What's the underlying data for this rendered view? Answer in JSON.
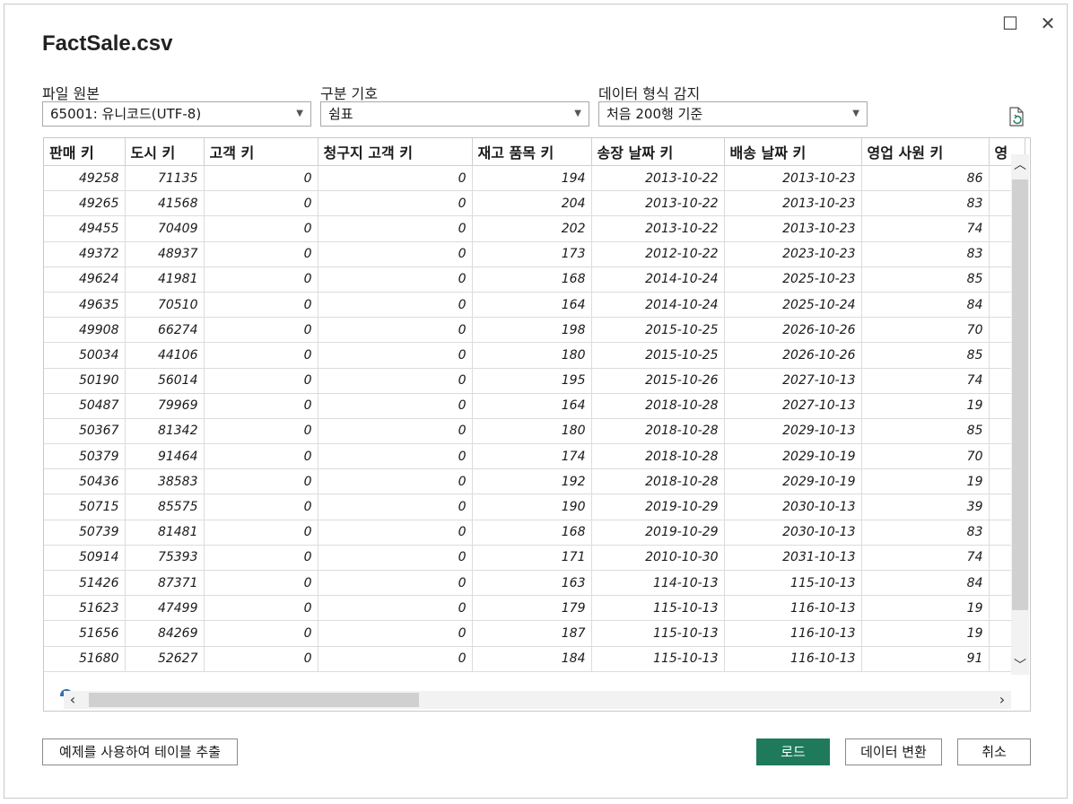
{
  "title": "FactSale.csv",
  "file_origin": {
    "label": "파일 원본",
    "value": "65001: 유니코드(UTF-8)"
  },
  "delimiter": {
    "label": "구분 기호",
    "value": "쉼표"
  },
  "detect": {
    "label": "데이터 형식 감지",
    "value": "처음 200행 기준"
  },
  "columns": [
    "판매 키",
    "도시 키",
    "고객 키",
    "청구지 고객 키",
    "재고 품목 키",
    "송장 날짜 키",
    "배송 날짜 키",
    "영업 사원 키",
    "영"
  ],
  "rows": [
    [
      "49258",
      "71135",
      "0",
      "0",
      "194",
      "2013-10-22",
      "2013-10-23",
      "86"
    ],
    [
      "49265",
      "41568",
      "0",
      "0",
      "204",
      "2013-10-22",
      "2013-10-23",
      "83"
    ],
    [
      "49455",
      "70409",
      "0",
      "0",
      "202",
      "2013-10-22",
      "2013-10-23",
      "74"
    ],
    [
      "49372",
      "48937",
      "0",
      "0",
      "173",
      "2012-10-22",
      "2023-10-23",
      "83"
    ],
    [
      "49624",
      "41981",
      "0",
      "0",
      "168",
      "2014-10-24",
      "2025-10-23",
      "85"
    ],
    [
      "49635",
      "70510",
      "0",
      "0",
      "164",
      "2014-10-24",
      "2025-10-24",
      "84"
    ],
    [
      "49908",
      "66274",
      "0",
      "0",
      "198",
      "2015-10-25",
      "2026-10-26",
      "70"
    ],
    [
      "50034",
      "44106",
      "0",
      "0",
      "180",
      "2015-10-25",
      "2026-10-26",
      "85"
    ],
    [
      "50190",
      "56014",
      "0",
      "0",
      "195",
      "2015-10-26",
      "2027-10-13",
      "74"
    ],
    [
      "50487",
      "79969",
      "0",
      "0",
      "164",
      "2018-10-28",
      "2027-10-13",
      "19"
    ],
    [
      "50367",
      "81342",
      "0",
      "0",
      "180",
      "2018-10-28",
      "2029-10-13",
      "85"
    ],
    [
      "50379",
      "91464",
      "0",
      "0",
      "174",
      "2018-10-28",
      "2029-10-19",
      "70"
    ],
    [
      "50436",
      "38583",
      "0",
      "0",
      "192",
      "2018-10-28",
      "2029-10-19",
      "19"
    ],
    [
      "50715",
      "85575",
      "0",
      "0",
      "190",
      "2019-10-29",
      "2030-10-13",
      "39"
    ],
    [
      "50739",
      "81481",
      "0",
      "0",
      "168",
      "2019-10-29",
      "2030-10-13",
      "83"
    ],
    [
      "50914",
      "75393",
      "0",
      "0",
      "171",
      "2010-10-30",
      "2031-10-13",
      "74"
    ],
    [
      "51426",
      "87371",
      "0",
      "0",
      "163",
      "114-10-13",
      "115-10-13",
      "84"
    ],
    [
      "51623",
      "47499",
      "0",
      "0",
      "179",
      "115-10-13",
      "116-10-13",
      "19"
    ],
    [
      "51656",
      "84269",
      "0",
      "0",
      "187",
      "115-10-13",
      "116-10-13",
      "19"
    ],
    [
      "51680",
      "52627",
      "0",
      "0",
      "184",
      "115-10-13",
      "116-10-13",
      "91"
    ]
  ],
  "buttons": {
    "extract": "예제를 사용하여 테이블 추출",
    "load": "로드",
    "transform": "데이터 변환",
    "cancel": "취소"
  },
  "icons": {
    "maximize": "maximize-icon",
    "close": "close-icon",
    "refresh": "refresh-file-icon"
  }
}
